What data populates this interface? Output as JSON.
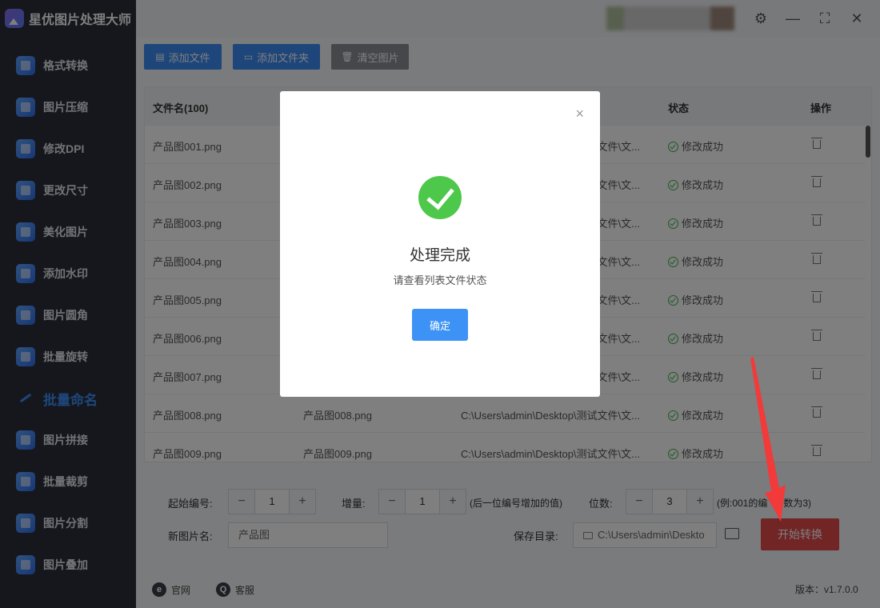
{
  "app": {
    "title": "星优图片处理大师"
  },
  "sidebar": {
    "items": [
      {
        "label": "格式转换"
      },
      {
        "label": "图片压缩"
      },
      {
        "label": "修改DPI"
      },
      {
        "label": "更改尺寸"
      },
      {
        "label": "美化图片"
      },
      {
        "label": "添加水印"
      },
      {
        "label": "图片圆角"
      },
      {
        "label": "批量旋转"
      },
      {
        "label": "批量命名"
      },
      {
        "label": "图片拼接"
      },
      {
        "label": "批量裁剪"
      },
      {
        "label": "图片分割"
      },
      {
        "label": "图片叠加"
      }
    ]
  },
  "toolbar": {
    "add_file": "添加文件",
    "add_folder": "添加文件夹",
    "clear": "清空图片"
  },
  "table": {
    "headers": {
      "filename": "文件名(100)",
      "status": "状态",
      "action": "操作"
    },
    "rows": [
      {
        "name": "产品图001.png",
        "new_name": "",
        "path": "文件\\文...",
        "status": "修改成功"
      },
      {
        "name": "产品图002.png",
        "new_name": "",
        "path": "文件\\文...",
        "status": "修改成功"
      },
      {
        "name": "产品图003.png",
        "new_name": "",
        "path": "文件\\文...",
        "status": "修改成功"
      },
      {
        "name": "产品图004.png",
        "new_name": "",
        "path": "文件\\文...",
        "status": "修改成功"
      },
      {
        "name": "产品图005.png",
        "new_name": "",
        "path": "文件\\文...",
        "status": "修改成功"
      },
      {
        "name": "产品图006.png",
        "new_name": "",
        "path": "文件\\文...",
        "status": "修改成功"
      },
      {
        "name": "产品图007.png",
        "new_name": "",
        "path": "文件\\文...",
        "status": "修改成功"
      },
      {
        "name": "产品图008.png",
        "new_name": "产品图008.png",
        "path": "C:\\Users\\admin\\Desktop\\测试文件\\文...",
        "status": "修改成功"
      },
      {
        "name": "产品图009.png",
        "new_name": "产品图009.png",
        "path": "C:\\Users\\admin\\Desktop\\测试文件\\文...",
        "status": "修改成功"
      }
    ]
  },
  "settings": {
    "start_label": "起始编号:",
    "start_value": "1",
    "inc_label": "增量:",
    "inc_value": "1",
    "inc_hint": "(后一位编号增加的值)",
    "digits_label": "位数:",
    "digits_value": "3",
    "digits_hint": "(例:001的编",
    "digits_hint_tail": "数为3)",
    "newname_label": "新图片名:",
    "newname_value": "产品图",
    "savedir_label": "保存目录:",
    "savedir_value": "C:\\Users\\admin\\Deskto",
    "start_button": "开始转换",
    "minus": "−",
    "plus": "+"
  },
  "footer": {
    "website": "官网",
    "support": "客服",
    "version": "版本：v1.7.0.0"
  },
  "modal": {
    "title": "处理完成",
    "subtitle": "请查看列表文件状态",
    "ok": "确定",
    "close": "×"
  },
  "window": {
    "settings": "⚙",
    "minimize": "—",
    "maximize": "⛶",
    "close": "✕"
  },
  "colors": {
    "primary": "#3d93f5",
    "danger": "#e24a4a",
    "success": "#4dc84a",
    "sidebar": "#2b2e38"
  }
}
